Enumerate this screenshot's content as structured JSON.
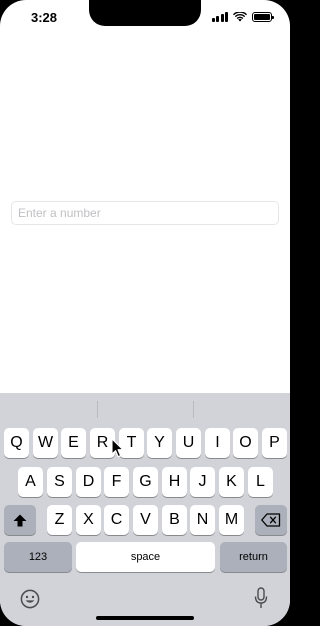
{
  "status_bar": {
    "time": "3:28"
  },
  "form": {
    "number_placeholder": "Enter a number"
  },
  "keyboard": {
    "row1": [
      "Q",
      "W",
      "E",
      "R",
      "T",
      "Y",
      "U",
      "I",
      "O",
      "P"
    ],
    "row2": [
      "A",
      "S",
      "D",
      "F",
      "G",
      "H",
      "J",
      "K",
      "L"
    ],
    "row3": [
      "Z",
      "X",
      "C",
      "V",
      "B",
      "N",
      "M"
    ],
    "numbers_label": "123",
    "space_label": "space",
    "return_label": "return"
  }
}
